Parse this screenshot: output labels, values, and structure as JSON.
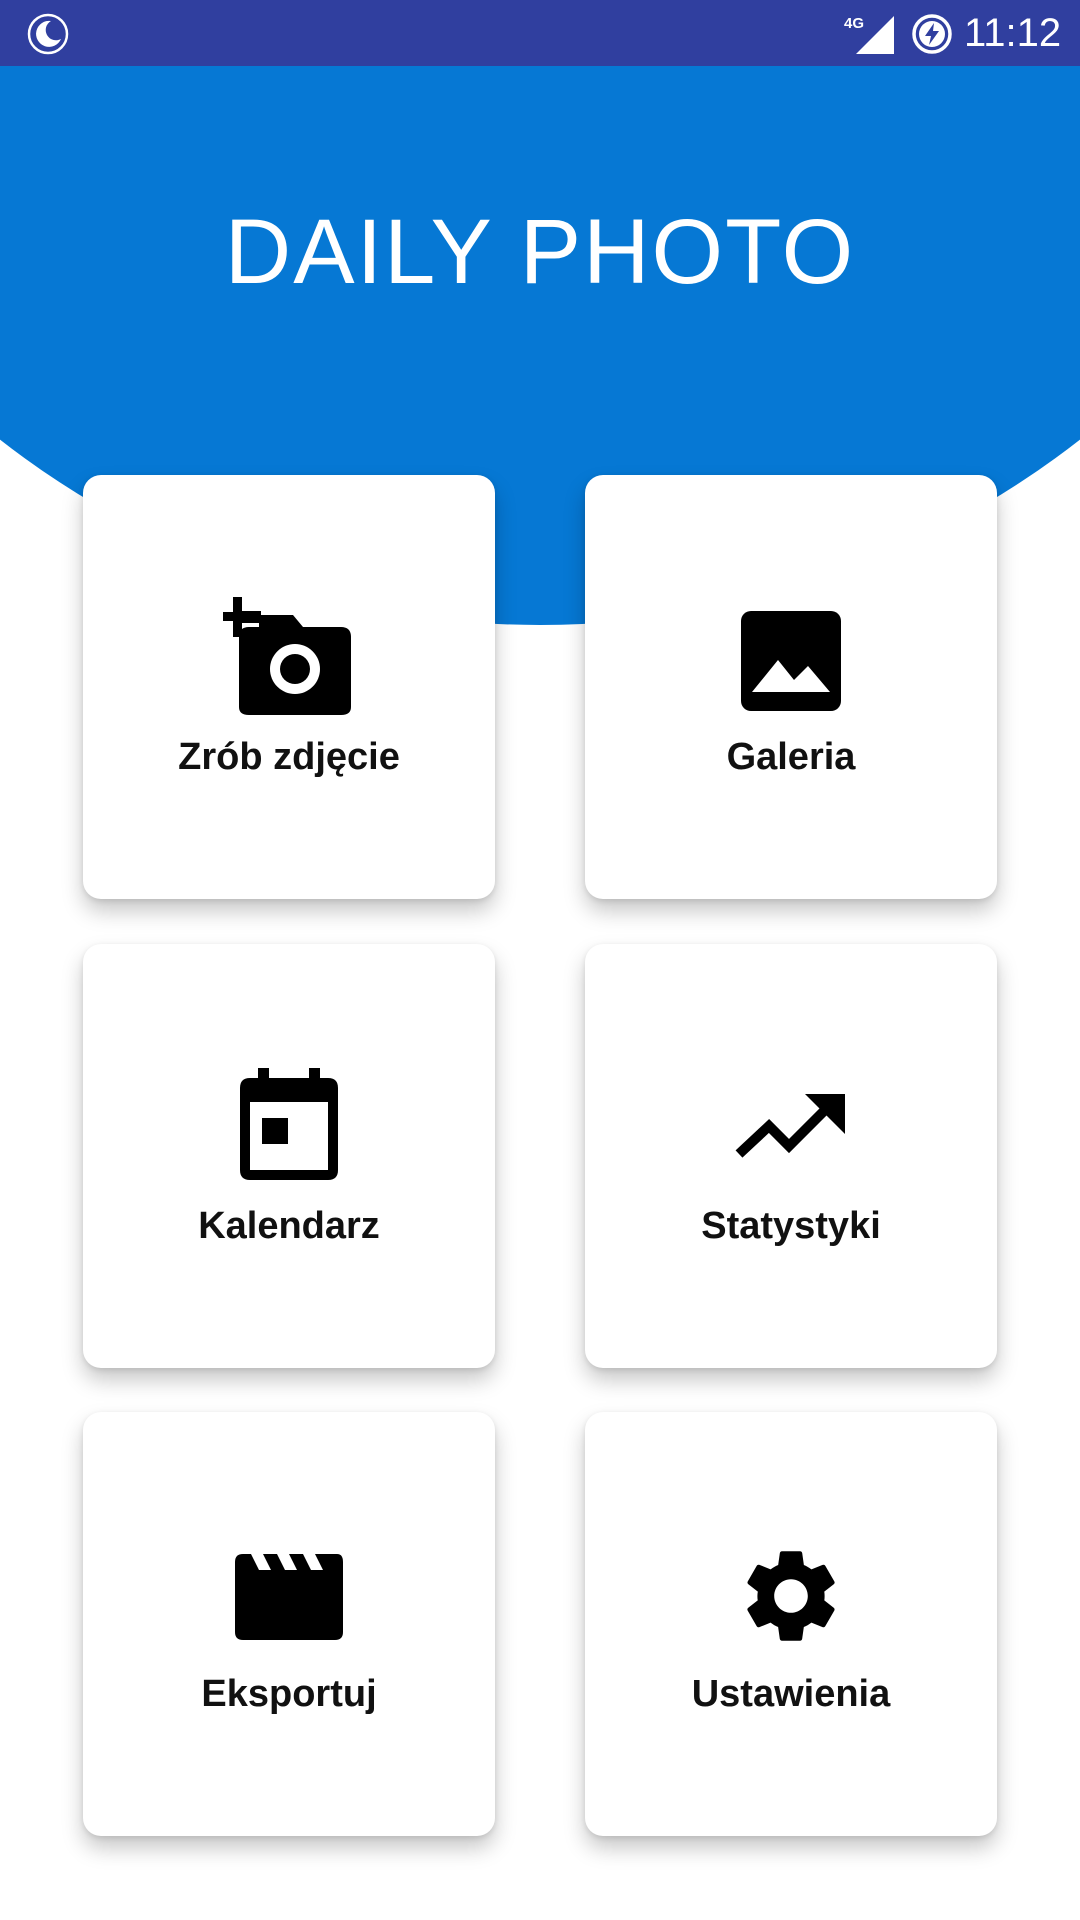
{
  "status_bar": {
    "time": "11:12",
    "network": "4G",
    "icons": [
      "moon-icon",
      "signal-icon",
      "battery-charging-icon"
    ],
    "background": "#303F9F"
  },
  "header": {
    "title": "DAILY PHOTO",
    "background": "#0678D4"
  },
  "menu": {
    "items": [
      {
        "label": "Zrób zdjęcie",
        "icon": "add-camera-icon"
      },
      {
        "label": "Galeria",
        "icon": "gallery-image-icon"
      },
      {
        "label": "Kalendarz",
        "icon": "calendar-icon"
      },
      {
        "label": "Statystyki",
        "icon": "trending-up-icon"
      },
      {
        "label": "Eksportuj",
        "icon": "clapperboard-icon"
      },
      {
        "label": "Ustawienia",
        "icon": "settings-gear-icon"
      }
    ]
  }
}
